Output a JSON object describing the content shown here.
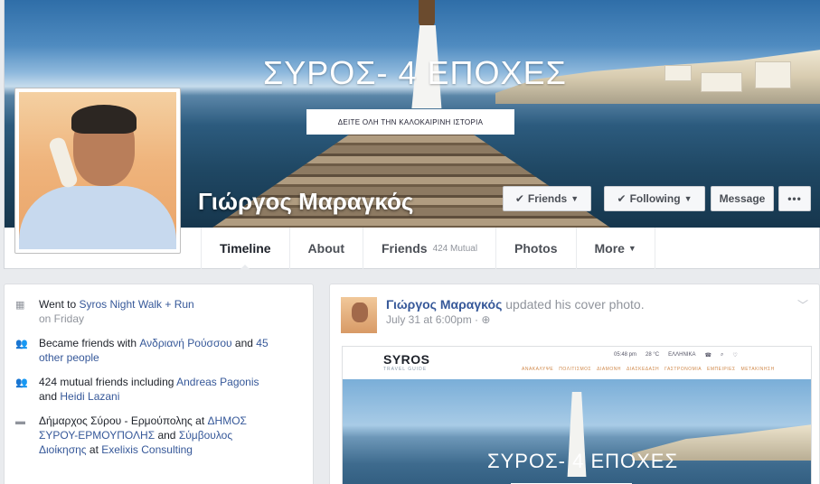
{
  "cover": {
    "title": "ΣΥΡΟΣ- 4 ΕΠΟΧΕΣ",
    "cta": "ΔΕΙΤΕ ΟΛΗ ΤΗΝ ΚΑΛΟΚΑΙΡΙΝΗ ΙΣΤΟΡΙΑ",
    "profile_name": "Γιώργος Μαραγκός"
  },
  "actions": {
    "friends_label": "Friends",
    "following_label": "Following",
    "message_label": "Message",
    "more_label": "•••"
  },
  "tabs": [
    {
      "label": "Timeline"
    },
    {
      "label": "About"
    },
    {
      "label": "Friends",
      "sub": "424 Mutual"
    },
    {
      "label": "Photos"
    },
    {
      "label": "More"
    }
  ],
  "intro": {
    "items": [
      {
        "icon": "calendar-icon",
        "pre": "Went to ",
        "link1": "Syros Night Walk + Run",
        "mid": "",
        "link2": "",
        "post": "",
        "sub": "on Friday"
      },
      {
        "icon": "friends-icon",
        "pre": "Became friends with ",
        "link1": "Ανδριανή Ρούσσου",
        "mid": " and ",
        "link2": "45",
        "post": "",
        "sub_link": "other people"
      },
      {
        "icon": "mutual-friends-icon",
        "pre": "424 mutual friends including ",
        "link1": "Andreas Pagonis",
        "mid": "",
        "link2": "",
        "post": "",
        "sub": "and ",
        "sub_link": "Heidi Lazani"
      },
      {
        "icon": "briefcase-icon",
        "pre": "Δήμαρχος Σύρου - Ερμούπολης at ",
        "link1": "ΔΗΜΟΣ",
        "line2_link": "ΣΥΡΟΥ-ΕΡΜΟΥΠΟΛΗΣ",
        "line2_mid": " and ",
        "line2_link2": "Σύμβουλος",
        "line3_link": "Διοίκησης",
        "line3_mid": " at ",
        "line3_link2": "Exelixis Consulting"
      }
    ]
  },
  "post": {
    "author": "Γιώργος Μαραγκός",
    "action": " updated his cover photo.",
    "time": "July 31 at 6:00pm · ",
    "image": {
      "site_logo": "SYROS",
      "site_sub": "TRAVEL GUIDE",
      "tools": [
        "05:48 pm",
        "28 °C",
        "ΕΛΛΗΝΙΚΑ"
      ],
      "nav": [
        "ΑΝΑΚΑΛΥΨΕ",
        "ΠΟΛΙΤΙΣΜΟΣ",
        "ΔΙΑΜΟΝΗ",
        "ΔΙΑΣΚΕΔΑΣΗ",
        "ΓΑΣΤΡΟΝΟΜΙΑ",
        "ΕΜΠΕΙΡΙΕΣ",
        "ΜΕΤΑΚΙΝΗΣΗ"
      ],
      "title": "ΣΥΡΟΣ- 4 ΕΠΟΧΕΣ"
    }
  }
}
